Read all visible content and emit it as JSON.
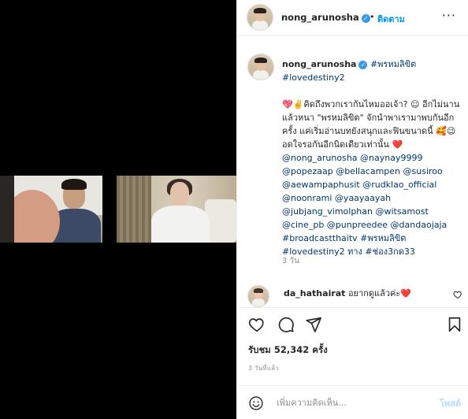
{
  "post": {
    "username": "nong_arunosha",
    "verified_icon": "verified-badge-icon",
    "follow_label": "ติดตาม",
    "separator": "•",
    "more_label": "···"
  },
  "caption": {
    "username": "nong_arunosha",
    "line1_tag": "#พรหมลิขิต",
    "line2_tag": "#lovedestiny2",
    "body_1": "💖✌️คิดถึงพวกเรากันไหมออเจ้า? ☺ อีกไม่นานแล้วหนา \"พรหมลิขิต\" จักนำพาเรามาพบกันอีกครั้ง แค่เริ่มอ่านบทยังสนุกและฟินขนาดนี้ 🥰😉 อดใจรอกันอีกนิดเดียวเท่านั้น ❤️",
    "mentions": "@nong_arunosha @naynay9999 @popezaap @bellacampen @susiroo @aewampaphusit @rudklao_official @noonrami @yaayaayah @jubjang_vimolphan @witsamost @cine_pb @punpreedee @dandaojaja",
    "hashtags_tail": "#broadcastthaitv #พรหมลิขิต #lovedestiny2 ทาง #ช่อง3กด33",
    "time": "3 วัน"
  },
  "comment": {
    "username": "da_hathairat",
    "text": "อยากดูแล้วค่ะ❤️"
  },
  "stats": {
    "views_label": "รับชม 52,342 ครั้ง",
    "posted": "3 วันที่แล้ว"
  },
  "add_comment": {
    "placeholder": "เพิ่มความคิดเห็น...",
    "post_label": "โพสต์"
  },
  "colors": {
    "accent": "#0095f6",
    "link": "#00376b",
    "muted": "#8e8e8e",
    "heart": "#ed4956"
  }
}
